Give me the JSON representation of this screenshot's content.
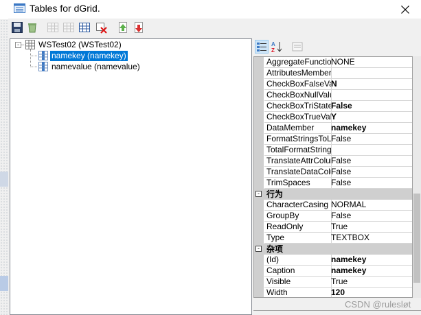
{
  "window": {
    "title": "Tables for dGrid.",
    "close_label": "X"
  },
  "toolbar": {
    "buttons": [
      "save-icon",
      "recycle-icon",
      "table-icon",
      "table-add-icon",
      "table-select-icon",
      "delete-icon",
      "move-up-icon",
      "move-down-icon"
    ]
  },
  "tree": {
    "root_label": "WSTest02 (WSTest02)",
    "root_expander": "-",
    "children": [
      {
        "label": "namekey (namekey)",
        "selected": true
      },
      {
        "label": "namevalue (namevalue)",
        "selected": false
      }
    ]
  },
  "property_grid": {
    "rows": [
      {
        "name": "AggregateFunction",
        "value": "NONE",
        "bold": false
      },
      {
        "name": "AttributesMember",
        "value": "",
        "bold": false
      },
      {
        "name": "CheckBoxFalseValue",
        "value": "N",
        "bold": true
      },
      {
        "name": "CheckBoxNullValue",
        "value": "",
        "bold": false
      },
      {
        "name": "CheckBoxTriState",
        "value": "False",
        "bold": true
      },
      {
        "name": "CheckBoxTrueValue",
        "value": "Y",
        "bold": true
      },
      {
        "name": "DataMember",
        "value": "namekey",
        "bold": true
      },
      {
        "name": "FormatStringsToLocalize",
        "value": "False",
        "bold": false
      },
      {
        "name": "TotalFormatString",
        "value": "",
        "bold": false
      },
      {
        "name": "TranslateAttrColumn",
        "value": "False",
        "bold": false
      },
      {
        "name": "TranslateDataColumn",
        "value": "False",
        "bold": false
      },
      {
        "name": "TrimSpaces",
        "value": "False",
        "bold": false
      }
    ],
    "category_behavior": "行为",
    "behavior_rows": [
      {
        "name": "CharacterCasing",
        "value": "NORMAL",
        "bold": false
      },
      {
        "name": "GroupBy",
        "value": "False",
        "bold": false
      },
      {
        "name": "ReadOnly",
        "value": "True",
        "bold": false
      },
      {
        "name": "Type",
        "value": "TEXTBOX",
        "bold": false
      }
    ],
    "category_misc": "杂项",
    "misc_rows": [
      {
        "name": "(Id)",
        "value": "namekey",
        "bold": true
      },
      {
        "name": "Caption",
        "value": "namekey",
        "bold": true
      },
      {
        "name": "Visible",
        "value": "True",
        "bold": false
      },
      {
        "name": "Width",
        "value": "120",
        "bold": true
      }
    ],
    "toggle": "-"
  },
  "watermark": "CSDN @rulesløt"
}
